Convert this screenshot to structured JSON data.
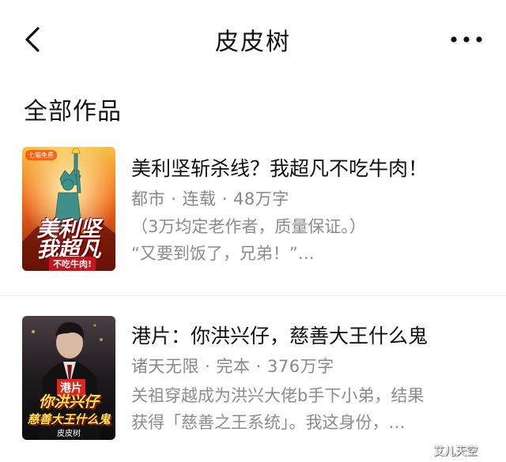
{
  "header": {
    "title": "皮皮树",
    "back_icon": "chevron-left-icon",
    "more_icon": "more-horizontal-icon"
  },
  "section": {
    "title": "全部作品"
  },
  "books": [
    {
      "title": "美利坚斩杀线？我超凡不吃牛肉！",
      "meta": "都市 · 连载 · 48万字",
      "desc_lines": [
        "（3万均定老作者，质量保证。）",
        "“又要到饭了，兄弟！”…"
      ],
      "cover": {
        "tag": "七猫免费",
        "title_lines": [
          "美利坚",
          "我超凡"
        ],
        "subtitle": "不吃牛肉!",
        "colors": {
          "top": "#f7b33a",
          "mid": "#ef6a1d",
          "bottom": "#8c1a0c",
          "statue": "#3f8f8a"
        }
      }
    },
    {
      "title": "港片：你洪兴仔，慈善大王什么鬼",
      "meta": "诸天无限 · 完本 · 376万字",
      "desc_lines": [
        "关祖穿越成为洪兴大佬b手下小弟，结果",
        "获得「慈善之王系统」。我这身份，…"
      ],
      "cover": {
        "badge": "港片",
        "title_lines": [
          "你洪兴仔",
          "慈善大王什么鬼"
        ],
        "author": "皮皮树",
        "colors": {
          "top": "#3a3236",
          "mid": "#1e1a1d",
          "bottom": "#0d0a0c",
          "accent": "#ffe14a"
        }
      }
    }
  ],
  "watermark": "艾儿天空"
}
